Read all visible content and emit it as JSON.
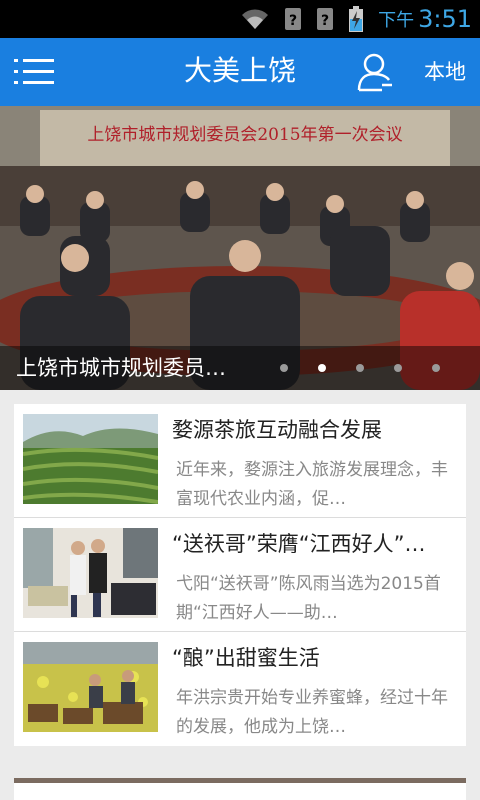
{
  "status_bar": {
    "ampm": "下午",
    "time": "3:51"
  },
  "app_bar": {
    "title": "大美上饶",
    "local_label": "本地"
  },
  "banner": {
    "title": "上饶市城市规划委员…",
    "slide_count": 5,
    "active_index": 1,
    "photo_banner_text": "上饶市城市规划委员会2015年第一次会议"
  },
  "news": [
    {
      "title": "婺源茶旅互动融合发展",
      "summary": "近年来，婺源注入旅游发展理念，丰富现代农业内涵，促…"
    },
    {
      "title": "“送祆哥”荣膺“江西好人”…",
      "summary": "弋阳“送祆哥”陈风雨当选为2015首期“江西好人——助…"
    },
    {
      "title": "“酿”出甜蜜生活",
      "summary": "年洪宗贵开始专业养蜜蜂，经过十年的发展，他成为上饶…"
    }
  ]
}
